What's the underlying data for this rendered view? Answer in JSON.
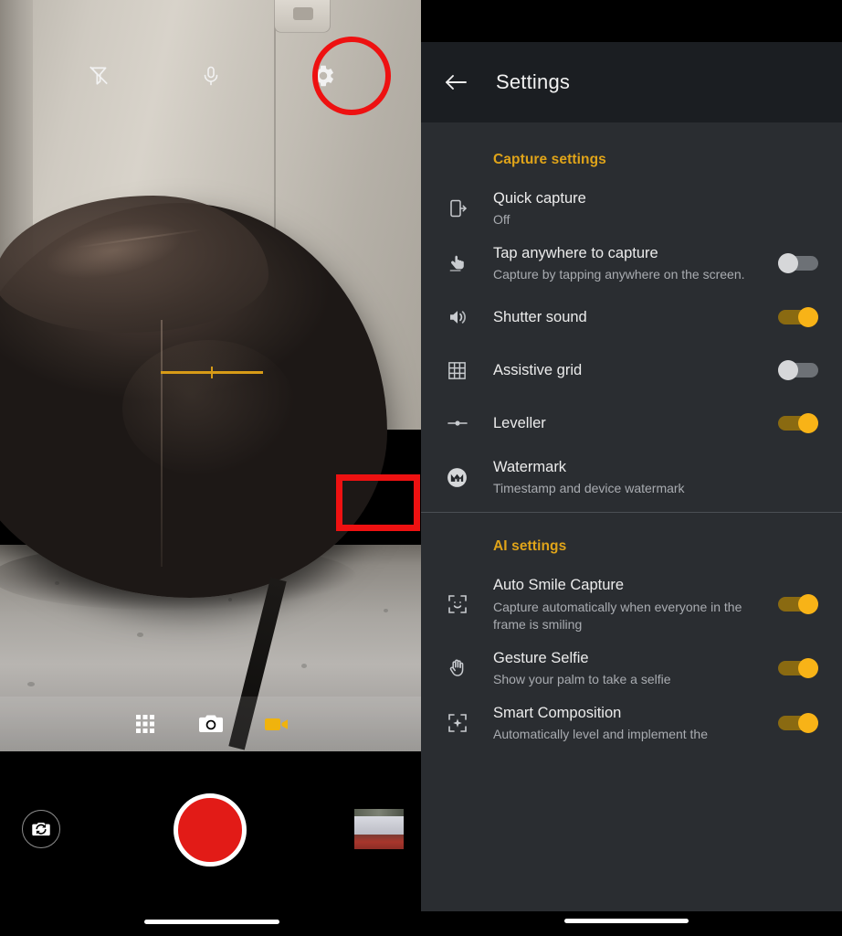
{
  "camera": {
    "top_controls": [
      {
        "name": "flash-off-icon",
        "label": "Flash off"
      },
      {
        "name": "microphone-icon",
        "label": "Microphone"
      },
      {
        "name": "gear-icon",
        "label": "Settings"
      }
    ],
    "gear_highlighted": true,
    "highlight_color": "#ee1111",
    "leveller_color": "#d79b17",
    "modes": [
      {
        "name": "more-modes-icon",
        "label": "More modes",
        "active": false
      },
      {
        "name": "photo-mode-icon",
        "label": "Photo",
        "active": false
      },
      {
        "name": "video-mode-icon",
        "label": "Video",
        "active": true
      }
    ],
    "active_mode_color": "#f0b30d",
    "flip_camera_label": "Switch camera",
    "shutter_label": "Record",
    "shutter_color": "#e21b17",
    "gallery_thumbnail_label": "Last capture"
  },
  "settings": {
    "app_bar": {
      "back_label": "Back",
      "title": "Settings"
    },
    "accent_color": "#e0a419",
    "sections": [
      {
        "id": "capture-settings",
        "header": "Capture settings",
        "rows": [
          {
            "id": "quick-capture",
            "icon": "quick-capture-icon",
            "title": "Quick capture",
            "subtitle": "Off",
            "control": "value"
          },
          {
            "id": "tap-anywhere-to-capture",
            "icon": "tap-finger-icon",
            "title": "Tap anywhere to capture",
            "subtitle": "Capture by tapping anywhere on the screen.",
            "control": "toggle",
            "toggle_state": "off"
          },
          {
            "id": "shutter-sound",
            "icon": "speaker-icon",
            "title": "Shutter sound",
            "subtitle": "",
            "control": "toggle",
            "toggle_state": "on"
          },
          {
            "id": "assistive-grid",
            "icon": "grid-icon",
            "title": "Assistive grid",
            "subtitle": "",
            "control": "toggle",
            "toggle_state": "off"
          },
          {
            "id": "leveller",
            "icon": "leveller-icon",
            "title": "Leveller",
            "subtitle": "",
            "control": "toggle",
            "toggle_state": "on",
            "highlighted": true
          },
          {
            "id": "watermark",
            "icon": "motorola-logo-icon",
            "title": "Watermark",
            "subtitle": "Timestamp and device watermark",
            "control": "none"
          }
        ]
      },
      {
        "id": "ai-settings",
        "header": "AI settings",
        "rows": [
          {
            "id": "auto-smile-capture",
            "icon": "smile-frame-icon",
            "title": "Auto Smile Capture",
            "subtitle": "Capture automatically when everyone in the frame is smiling",
            "control": "toggle",
            "toggle_state": "on"
          },
          {
            "id": "gesture-selfie",
            "icon": "palm-icon",
            "title": "Gesture Selfie",
            "subtitle": "Show your palm to take a selfie",
            "control": "toggle",
            "toggle_state": "on"
          },
          {
            "id": "smart-composition",
            "icon": "sparkle-frame-icon",
            "title": "Smart Composition",
            "subtitle": "Automatically level and implement the",
            "control": "toggle",
            "toggle_state": "on"
          }
        ]
      }
    ]
  }
}
